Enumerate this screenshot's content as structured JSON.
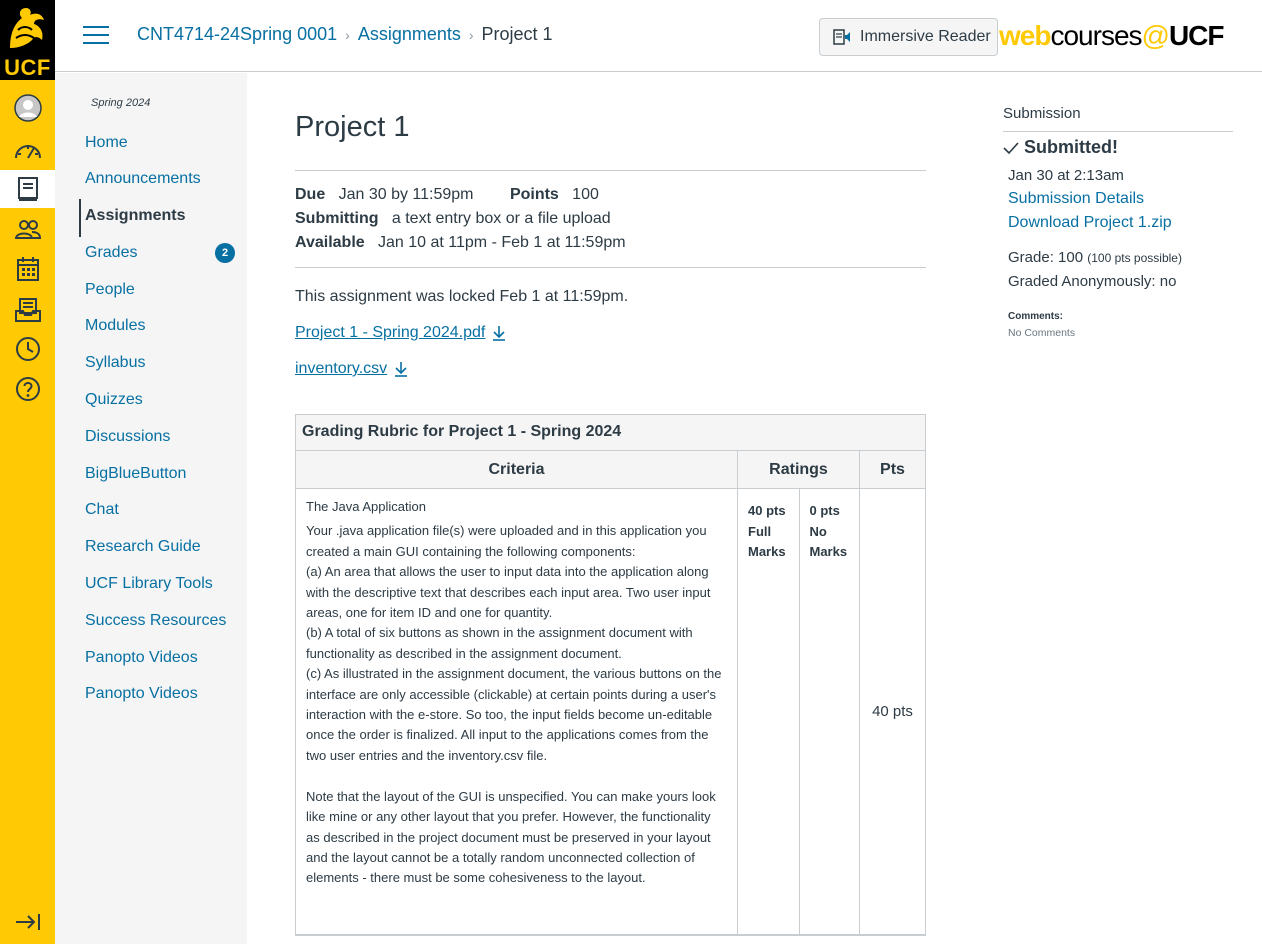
{
  "global_nav": {
    "logo_text": "UCF",
    "items": [
      {
        "name": "account-icon",
        "active": false
      },
      {
        "name": "dashboard-icon",
        "active": false
      },
      {
        "name": "courses-icon",
        "active": true
      },
      {
        "name": "groups-icon",
        "active": false
      },
      {
        "name": "calendar-icon",
        "active": false
      },
      {
        "name": "inbox-icon",
        "active": false
      },
      {
        "name": "history-icon",
        "active": false
      },
      {
        "name": "help-icon",
        "active": false
      }
    ],
    "accent_color": "#ffc904"
  },
  "header": {
    "breadcrumb": [
      "CNT4714-24Spring 0001",
      "Assignments",
      "Project 1"
    ],
    "immersive_reader_label": "Immersive Reader",
    "brand": {
      "web": "web",
      "courses": "courses",
      "at": "@",
      "ucf": "UCF"
    }
  },
  "course_nav": {
    "term": "Spring 2024",
    "items": [
      {
        "label": "Home"
      },
      {
        "label": "Announcements"
      },
      {
        "label": "Assignments",
        "active": true
      },
      {
        "label": "Grades",
        "badge": "2"
      },
      {
        "label": "People"
      },
      {
        "label": "Modules"
      },
      {
        "label": "Syllabus"
      },
      {
        "label": "Quizzes"
      },
      {
        "label": "Discussions"
      },
      {
        "label": "BigBlueButton"
      },
      {
        "label": "Chat"
      },
      {
        "label": "Research Guide"
      },
      {
        "label": "UCF Library Tools"
      },
      {
        "label": "Success Resources"
      },
      {
        "label": "Panopto Videos"
      },
      {
        "label": "Panopto Videos"
      }
    ]
  },
  "assignment": {
    "title": "Project 1",
    "due_label": "Due",
    "due": "Jan 30 by 11:59pm",
    "points_label": "Points",
    "points": "100",
    "submitting_label": "Submitting",
    "submitting": "a text entry box or a file upload",
    "available_label": "Available",
    "available": "Jan 10 at 11pm - Feb 1 at 11:59pm",
    "locked_message": "This assignment was locked Feb 1 at 11:59pm.",
    "files": [
      "Project 1 - Spring 2024.pdf",
      "inventory.csv"
    ]
  },
  "rubric": {
    "title": "Grading Rubric for Project 1 - Spring 2024",
    "headers": {
      "criteria": "Criteria",
      "ratings": "Ratings",
      "pts": "Pts"
    },
    "rows": [
      {
        "criterion_title": "The Java Application",
        "criterion_desc": "Your .java application file(s) were uploaded and in this application you created a main GUI containing the following components:\n(a) An area that allows the user to input data into the application along with the descriptive text that describes each input area. Two user input areas, one for item ID and one for quantity.\n(b) A total of six buttons as shown in the assignment document with functionality as described in the assignment document.\n(c) As illustrated in the assignment document, the various buttons on the interface are only accessible (clickable) at certain points during a user's interaction with the e-store. So too, the input fields become un-editable once the order is finalized. All input to the applications comes from the two user entries and the inventory.csv file.\n\nNote that the layout of the GUI is unspecified. You can make yours look like mine or any other layout that you prefer. However, the functionality as described in the project document must be preserved in your layout and the layout cannot be a totally random unconnected collection of elements - there must be some cohesiveness to the layout.",
        "ratings": [
          {
            "pts": "40 pts",
            "label": "Full Marks"
          },
          {
            "pts": "0 pts",
            "label": "No Marks"
          }
        ],
        "pts": "40 pts"
      }
    ]
  },
  "submission": {
    "heading": "Submission",
    "status": "Submitted!",
    "date": "Jan 30 at 2:13am",
    "details_link": "Submission Details",
    "download_link": "Download Project 1.zip",
    "grade_label": "Grade: 100",
    "grade_possible": "(100 pts possible)",
    "anonymous": "Graded Anonymously: no",
    "comments_label": "Comments:",
    "comments": "No Comments"
  }
}
